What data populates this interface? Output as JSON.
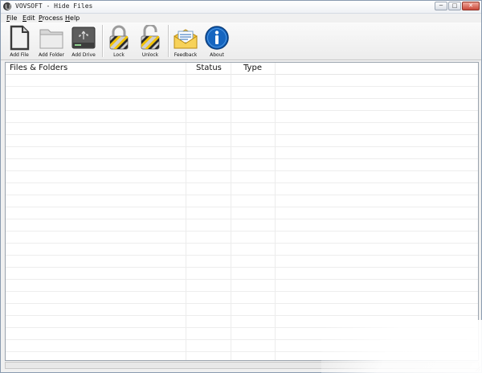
{
  "window": {
    "title": "VOVSOFT - Hide Files"
  },
  "caption_buttons": {
    "minimize": "─",
    "maximize": "□",
    "close": "✕"
  },
  "menu": [
    {
      "accel": "F",
      "rest": "ile"
    },
    {
      "accel": "E",
      "rest": "dit"
    },
    {
      "accel": "P",
      "rest": "rocess"
    },
    {
      "accel": "H",
      "rest": "elp"
    }
  ],
  "toolbar": {
    "add_file": "Add File",
    "add_folder": "Add Folder",
    "add_drive": "Add Drive",
    "lock": "Lock",
    "unlock": "Unlock",
    "feedback": "Feedback",
    "about": "About"
  },
  "icons": {
    "add_file": "document-icon",
    "add_folder": "folder-icon",
    "add_drive": "usb-drive-icon",
    "lock": "padlock-closed-icon",
    "unlock": "padlock-open-icon",
    "feedback": "envelope-icon",
    "about": "info-icon"
  },
  "colors": {
    "about_blue": "#1565c0",
    "lock_stripe_yellow": "#f2c200",
    "feedback_yellow": "#f4c33a"
  },
  "list": {
    "columns": [
      "Files & Folders",
      "Status",
      "Type"
    ],
    "rows": []
  }
}
